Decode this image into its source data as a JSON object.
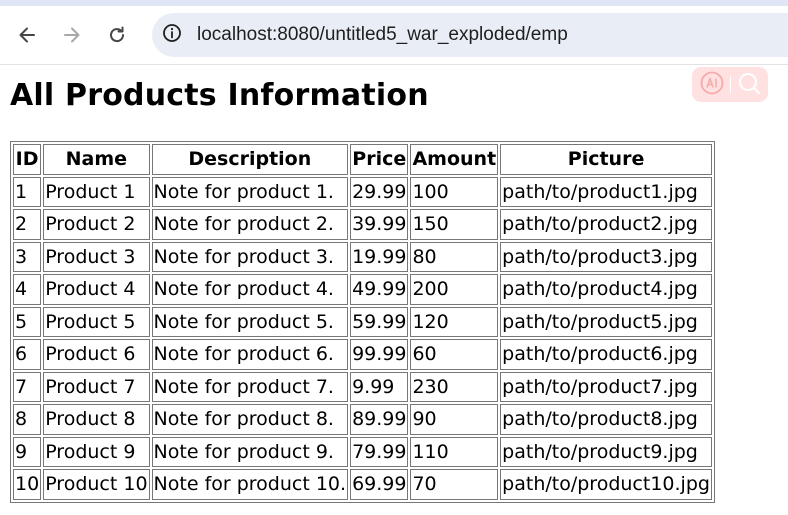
{
  "browser": {
    "url": "localhost:8080/untitled5_war_exploded/emp",
    "back_icon": "arrow-left-icon",
    "forward_icon": "arrow-right-icon",
    "reload_icon": "reload-icon",
    "site_info_icon": "info-circle-icon",
    "ai_icon": "ai-badge-icon",
    "search_icon": "search-icon"
  },
  "page": {
    "title": "All Products Information"
  },
  "table": {
    "headers": [
      "ID",
      "Name",
      "Description",
      "Price",
      "Amount",
      "Picture"
    ],
    "rows": [
      [
        "1",
        "Product 1",
        "Note for product 1.",
        "29.99",
        "100",
        "path/to/product1.jpg"
      ],
      [
        "2",
        "Product 2",
        "Note for product 2.",
        "39.99",
        "150",
        "path/to/product2.jpg"
      ],
      [
        "3",
        "Product 3",
        "Note for product 3.",
        "19.99",
        "80",
        "path/to/product3.jpg"
      ],
      [
        "4",
        "Product 4",
        "Note for product 4.",
        "49.99",
        "200",
        "path/to/product4.jpg"
      ],
      [
        "5",
        "Product 5",
        "Note for product 5.",
        "59.99",
        "120",
        "path/to/product5.jpg"
      ],
      [
        "6",
        "Product 6",
        "Note for product 6.",
        "99.99",
        "60",
        "path/to/product6.jpg"
      ],
      [
        "7",
        "Product 7",
        "Note for product 7.",
        "9.99",
        "230",
        "path/to/product7.jpg"
      ],
      [
        "8",
        "Product 8",
        "Note for product 8.",
        "89.99",
        "90",
        "path/to/product8.jpg"
      ],
      [
        "9",
        "Product 9",
        "Note for product 9.",
        "79.99",
        "110",
        "path/to/product9.jpg"
      ],
      [
        "10",
        "Product 10",
        "Note for product 10.",
        "69.99",
        "70",
        "path/to/product10.jpg"
      ]
    ]
  },
  "colors": {
    "address_bar": "#e9eef6",
    "ai_widget": "#ffdede",
    "ai_widget_icon": "#f6a3a3",
    "table_border": "#777777"
  }
}
